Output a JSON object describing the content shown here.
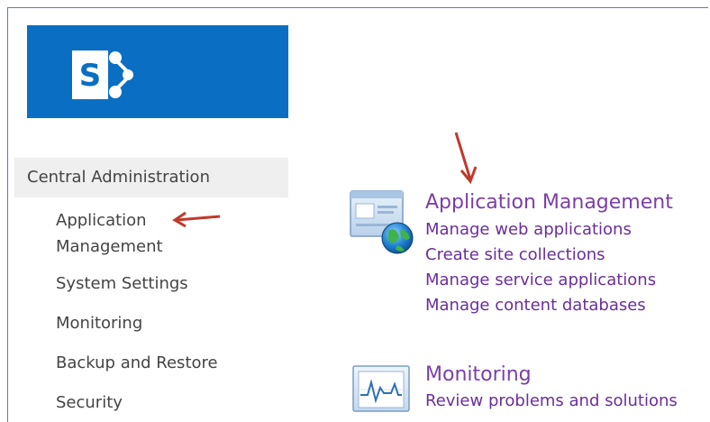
{
  "sidebar": {
    "header": "Central Administration",
    "items": [
      {
        "label": "Application Management"
      },
      {
        "label": "System Settings"
      },
      {
        "label": "Monitoring"
      },
      {
        "label": "Backup and Restore"
      },
      {
        "label": "Security"
      }
    ]
  },
  "sections": [
    {
      "title": "Application Management",
      "icon": "globe-window-icon",
      "links": [
        "Manage web applications",
        "Create site collections",
        "Manage service applications",
        "Manage content databases"
      ]
    },
    {
      "title": "Monitoring",
      "icon": "monitoring-chart-icon",
      "links": [
        "Review problems and solutions"
      ]
    }
  ],
  "annotations": {
    "arrow_color": "#c0392b"
  },
  "brand": {
    "logo_color": "#0a6fc3",
    "logo_letter": "S"
  }
}
